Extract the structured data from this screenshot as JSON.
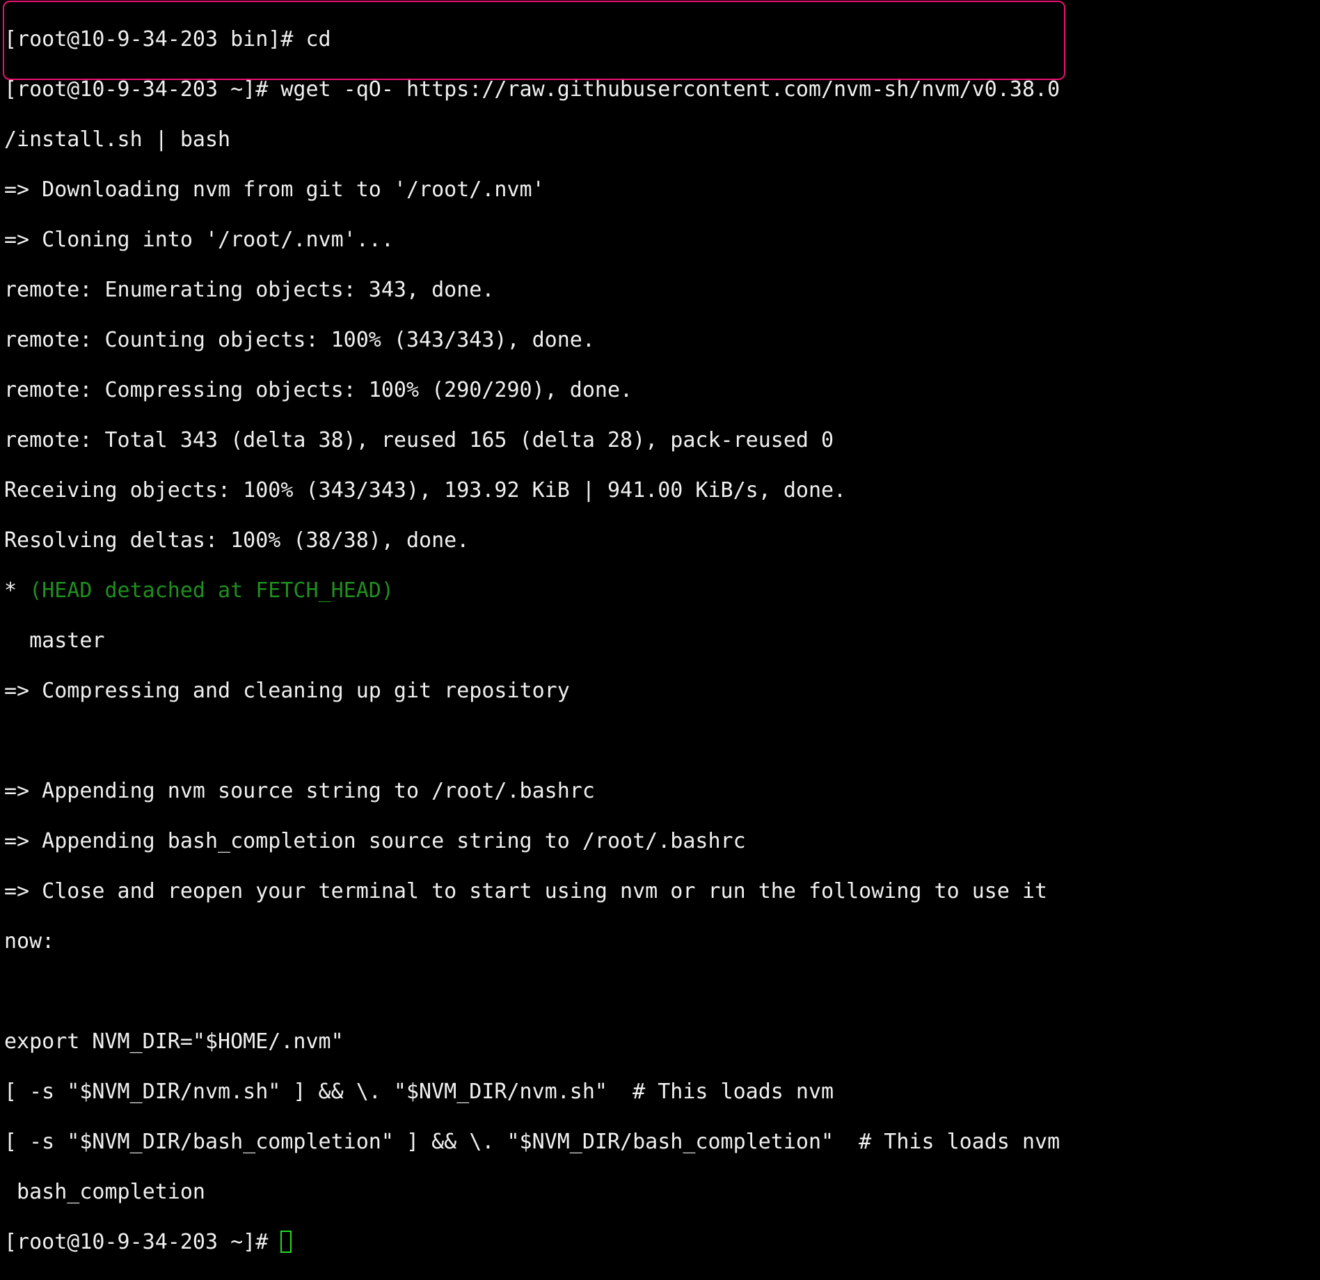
{
  "lines": [
    "[root@10-9-34-203 bin]# cd",
    "[root@10-9-34-203 ~]# wget -qO- https://raw.githubusercontent.com/nvm-sh/nvm/v0.38.0",
    "/install.sh | bash",
    "=> Downloading nvm from git to '/root/.nvm'",
    "=> Cloning into '/root/.nvm'...",
    "remote: Enumerating objects: 343, done.",
    "remote: Counting objects: 100% (343/343), done.",
    "remote: Compressing objects: 100% (290/290), done.",
    "remote: Total 343 (delta 38), reused 165 (delta 28), pack-reused 0",
    "Receiving objects: 100% (343/343), 193.92 KiB | 941.00 KiB/s, done.",
    "Resolving deltas: 100% (38/38), done.",
    "* ",
    "  master",
    "=> Compressing and cleaning up git repository",
    "",
    "=> Appending nvm source string to /root/.bashrc",
    "=> Appending bash_completion source string to /root/.bashrc",
    "=> Close and reopen your terminal to start using nvm or run the following to use it",
    "now:",
    "",
    "export NVM_DIR=\"$HOME/.nvm\"",
    "[ -s \"$NVM_DIR/nvm.sh\" ] && \\. \"$NVM_DIR/nvm.sh\"  # This loads nvm",
    "[ -s \"$NVM_DIR/bash_completion\" ] && \\. \"$NVM_DIR/bash_completion\"  # This loads nvm",
    " bash_completion",
    "[root@10-9-34-203 ~]# "
  ],
  "head_detached": "(HEAD detached at FETCH_HEAD)",
  "colors": {
    "highlight": "#ea1173",
    "branch": "#1f8f1f",
    "cursor": "#22dd22"
  }
}
